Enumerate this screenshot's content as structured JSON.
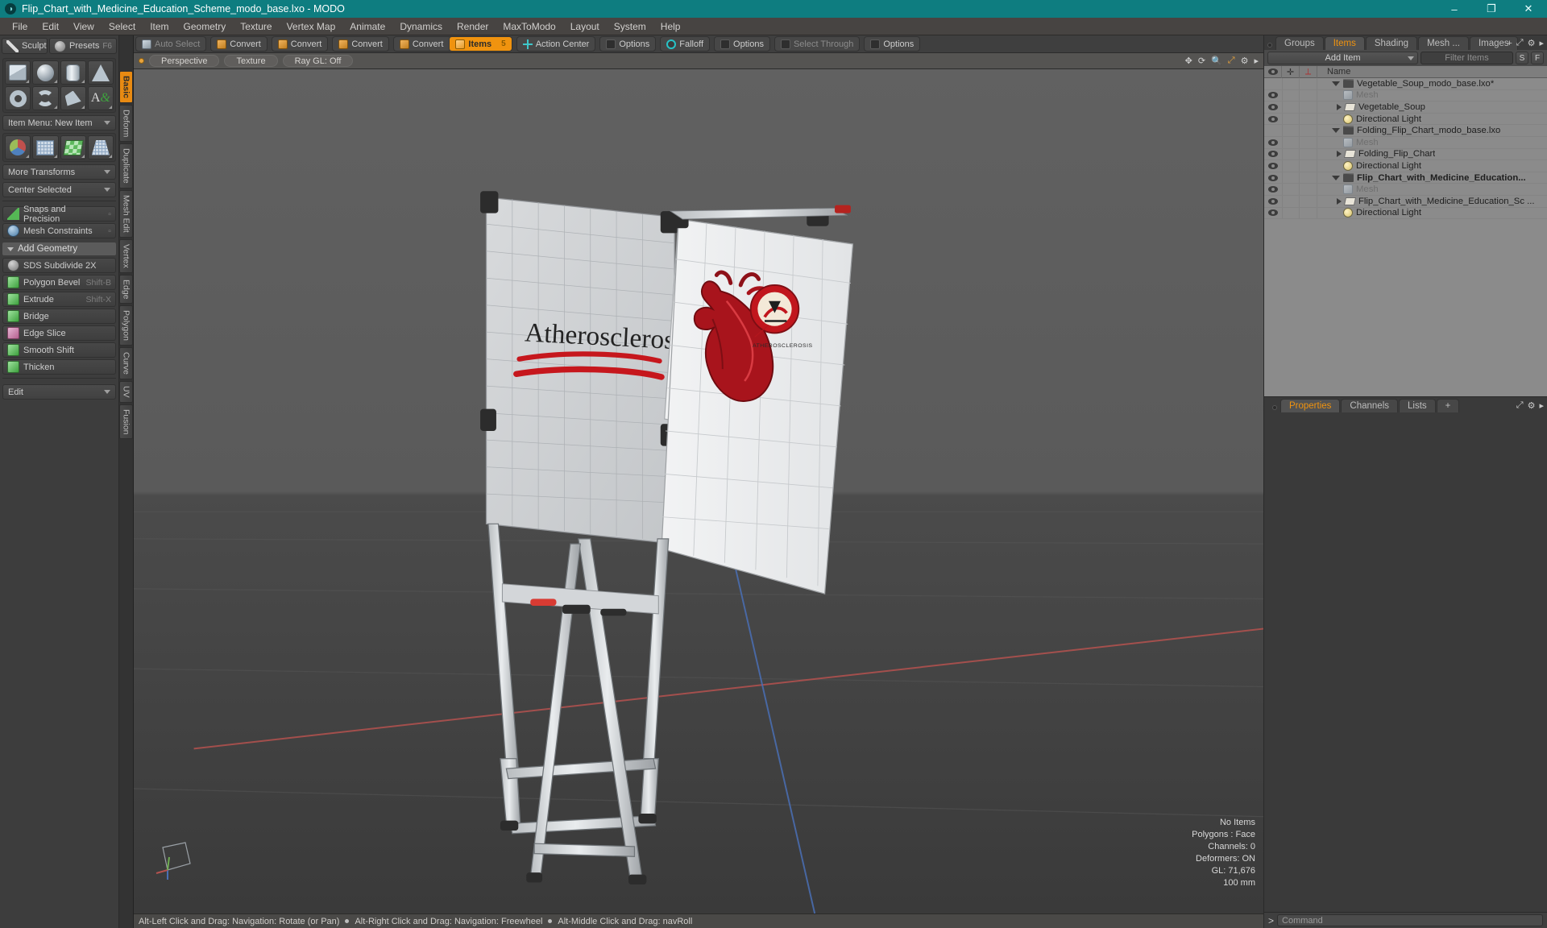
{
  "window": {
    "title": "Flip_Chart_with_Medicine_Education_Scheme_modo_base.lxo - MODO",
    "logo": "modo-logo",
    "minimize": "–",
    "maximize": "❐",
    "close": "✕"
  },
  "menubar": [
    "File",
    "Edit",
    "View",
    "Select",
    "Item",
    "Geometry",
    "Texture",
    "Vertex Map",
    "Animate",
    "Dynamics",
    "Render",
    "MaxToModo",
    "Layout",
    "System",
    "Help"
  ],
  "left_panel": {
    "sculpt_label": "Sculpt",
    "presets_label": "Presets",
    "presets_hint": "F6",
    "primitives_row1": [
      "cube-icon",
      "sphere-icon",
      "cylinder-icon",
      "cone-icon"
    ],
    "primitives_row2": [
      "torus-icon",
      "spline-icon",
      "polygon-icon",
      "text-icon"
    ],
    "item_menu": "Item Menu: New Item",
    "transform_row": [
      "transform-axis-icon",
      "grid-plane-icon",
      "checker-plane-icon",
      "taper-grid-icon"
    ],
    "more_transforms": "More Transforms",
    "center_selected": "Center Selected",
    "snaps": "Snaps and Precision",
    "mesh_constraints": "Mesh Constraints",
    "add_geometry": "Add Geometry",
    "tools": [
      {
        "label": "SDS Subdivide 2X",
        "hint": "",
        "icon": "sphere-gray-icon"
      },
      {
        "label": "Polygon Bevel",
        "hint": "Shift-B",
        "icon": "cube-green-icon"
      },
      {
        "label": "Extrude",
        "hint": "Shift-X",
        "icon": "cube-green-icon"
      },
      {
        "label": "Bridge",
        "hint": "",
        "icon": "bridge-green-icon"
      },
      {
        "label": "Edge Slice",
        "hint": "",
        "icon": "cube-pink-icon"
      },
      {
        "label": "Smooth Shift",
        "hint": "",
        "icon": "smooth-green-icon"
      },
      {
        "label": "Thicken",
        "hint": "",
        "icon": "cube-green-icon"
      }
    ],
    "edit_dropdown": "Edit"
  },
  "vertical_tabs": [
    {
      "label": "Basic",
      "active": true
    },
    {
      "label": "Deform",
      "active": false
    },
    {
      "label": "Duplicate",
      "active": false
    },
    {
      "label": "Mesh Edit",
      "active": false
    },
    {
      "label": "Vertex",
      "active": false
    },
    {
      "label": "Edge",
      "active": false
    },
    {
      "label": "Polygon",
      "active": false
    },
    {
      "label": "Curve",
      "active": false
    },
    {
      "label": "UV",
      "active": false
    },
    {
      "label": "Fusion",
      "active": false
    }
  ],
  "toolbar": {
    "groups": [
      {
        "buttons": [
          {
            "label": "Auto Select",
            "icon": "mesh-icon",
            "state": "dim"
          }
        ]
      },
      {
        "buttons": [
          {
            "label": "Convert",
            "icon": "convert-icon",
            "state": "normal"
          }
        ]
      },
      {
        "buttons": [
          {
            "label": "Convert",
            "icon": "convert-icon",
            "state": "normal"
          }
        ]
      },
      {
        "buttons": [
          {
            "label": "Convert",
            "icon": "convert-icon",
            "state": "normal"
          }
        ]
      },
      {
        "buttons": [
          {
            "label": "Convert",
            "icon": "convert-icon",
            "state": "normal"
          },
          {
            "label": "Items",
            "icon": "items-icon",
            "state": "active",
            "badge": "5"
          }
        ]
      },
      {
        "buttons": [
          {
            "label": "Action Center",
            "icon": "action-center-icon",
            "state": "normal"
          }
        ]
      },
      {
        "buttons": [
          {
            "label": "Options",
            "icon": "options-icon",
            "state": "normal"
          }
        ]
      },
      {
        "buttons": [
          {
            "label": "Falloff",
            "icon": "falloff-icon",
            "state": "normal"
          }
        ]
      },
      {
        "buttons": [
          {
            "label": "Options",
            "icon": "options-icon",
            "state": "normal"
          }
        ]
      },
      {
        "buttons": [
          {
            "label": "Select Through",
            "icon": "select-through-icon",
            "state": "dim"
          }
        ]
      },
      {
        "buttons": [
          {
            "label": "Options",
            "icon": "options-icon",
            "state": "normal"
          }
        ]
      }
    ]
  },
  "viewport_header": {
    "view_mode": "Perspective",
    "shading": "Texture",
    "raygl": "Ray GL: Off",
    "icons": [
      "move-icon",
      "rotate-icon",
      "zoom-icon",
      "fit-icon",
      "gear-icon",
      "chevron-right-icon"
    ]
  },
  "viewport": {
    "scene_title": "Atherosclerosis",
    "page2_caption": "ATHEROSCLEROSIS",
    "info": [
      "No Items",
      "Polygons : Face",
      "Channels: 0",
      "Deformers: ON",
      "GL: 71,676",
      "100 mm"
    ],
    "axis_gizmo": "axis-gizmo"
  },
  "statusbar": {
    "hints": [
      "Alt-Left Click and Drag: Navigation: Rotate (or Pan)",
      "Alt-Right Click and Drag: Navigation: Freewheel",
      "Alt-Middle Click and Drag: navRoll"
    ]
  },
  "right_panel": {
    "tabs": [
      {
        "label": "Groups",
        "active": false
      },
      {
        "label": "Items",
        "active": true
      },
      {
        "label": "Shading",
        "active": false
      },
      {
        "label": "Mesh ...",
        "active": false
      },
      {
        "label": "Images",
        "active": false
      }
    ],
    "tab_icons": [
      "plus-icon",
      "expand-icon",
      "gear-icon",
      "chevron-right-icon"
    ],
    "add_item": "Add Item",
    "filter_placeholder": "Filter Items",
    "btn_s": "S",
    "btn_f": "F",
    "columns": [
      "eye-icon",
      "add-icon",
      "transform-icon",
      "Name"
    ],
    "tree": [
      {
        "name": "Vegetable_Soup_modo_base.lxo*",
        "icon": "scene-icon",
        "depth": 0,
        "expander": "down",
        "eye": false,
        "dim": false,
        "bold": false
      },
      {
        "name": "Mesh",
        "icon": "mesh-icon",
        "depth": 1,
        "expander": "leaf",
        "eye": true,
        "dim": true,
        "bold": false
      },
      {
        "name": "Vegetable_Soup",
        "icon": "folder-icon",
        "depth": 1,
        "expander": "right",
        "eye": true,
        "dim": false,
        "bold": false
      },
      {
        "name": "Directional Light",
        "icon": "light-icon",
        "depth": 1,
        "expander": "leaf",
        "eye": true,
        "dim": false,
        "bold": false
      },
      {
        "name": "Folding_Flip_Chart_modo_base.lxo",
        "icon": "scene-icon",
        "depth": 0,
        "expander": "down",
        "eye": false,
        "dim": false,
        "bold": false
      },
      {
        "name": "Mesh",
        "icon": "mesh-icon",
        "depth": 1,
        "expander": "leaf",
        "eye": true,
        "dim": true,
        "bold": false
      },
      {
        "name": "Folding_Flip_Chart",
        "icon": "folder-icon",
        "depth": 1,
        "expander": "right",
        "eye": true,
        "dim": false,
        "bold": false
      },
      {
        "name": "Directional Light",
        "icon": "light-icon",
        "depth": 1,
        "expander": "leaf",
        "eye": true,
        "dim": false,
        "bold": false
      },
      {
        "name": "Flip_Chart_with_Medicine_Education...",
        "icon": "scene-icon",
        "depth": 0,
        "expander": "down",
        "eye": true,
        "dim": false,
        "bold": true
      },
      {
        "name": "Mesh",
        "icon": "mesh-icon",
        "depth": 1,
        "expander": "leaf",
        "eye": true,
        "dim": true,
        "bold": false
      },
      {
        "name": "Flip_Chart_with_Medicine_Education_Sc ...",
        "icon": "folder-icon",
        "depth": 1,
        "expander": "right",
        "eye": true,
        "dim": false,
        "bold": false
      },
      {
        "name": "Directional Light",
        "icon": "light-icon",
        "depth": 1,
        "expander": "leaf",
        "eye": true,
        "dim": false,
        "bold": false
      }
    ],
    "props_tabs": [
      {
        "label": "Properties",
        "active": true
      },
      {
        "label": "Channels",
        "active": false
      },
      {
        "label": "Lists",
        "active": false
      },
      {
        "label": "+",
        "active": false
      }
    ],
    "props_icons": [
      "expand-icon",
      "gear-icon",
      "chevron-right-icon"
    ]
  },
  "command_bar": {
    "prompt": ">",
    "placeholder": "Command"
  },
  "colors": {
    "title_bg": "#0e7d80",
    "accent_orange": "#f0930f",
    "panel_bg": "#3a3a3a",
    "tree_bg": "#8b8b8b",
    "viewport_top": "#5e5e5e",
    "viewport_bottom": "#3d3d3d",
    "heart_red": "#b41c22"
  }
}
